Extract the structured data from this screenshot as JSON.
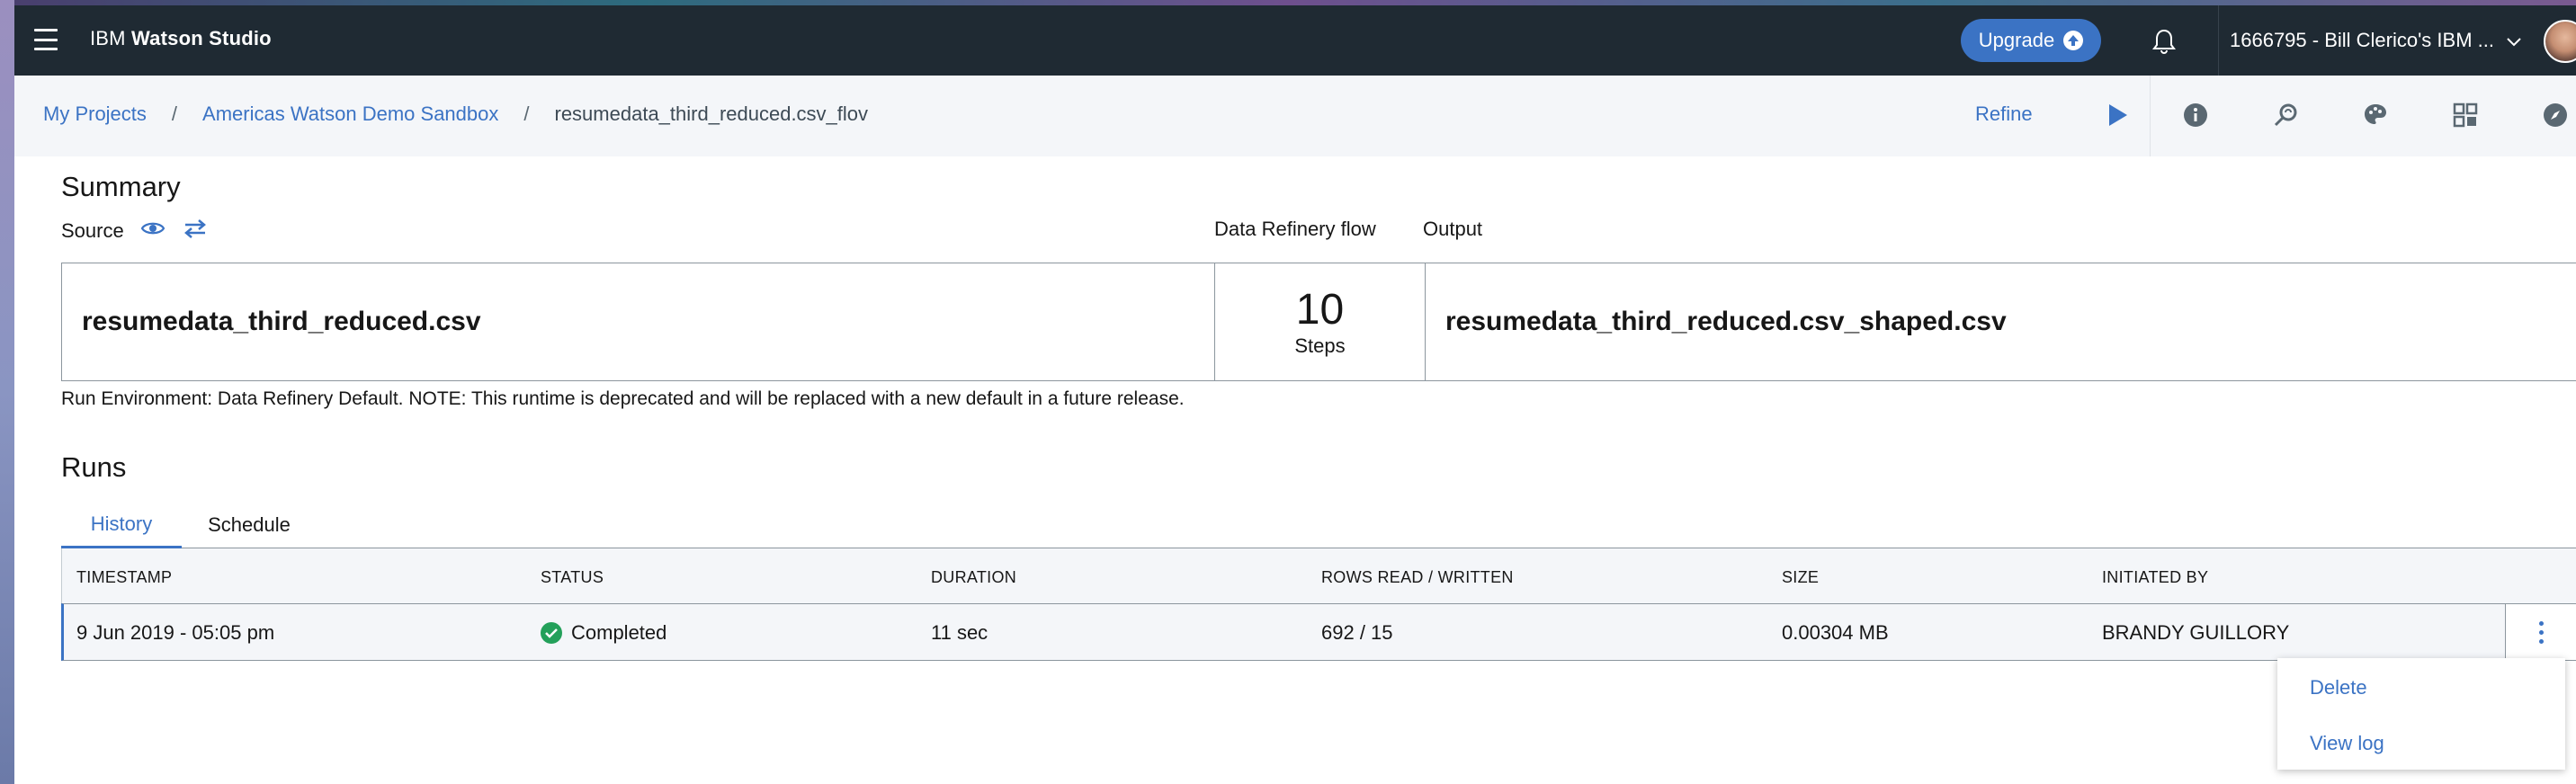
{
  "header": {
    "brand_prefix": "IBM",
    "brand_name": "Watson Studio",
    "upgrade_label": "Upgrade",
    "account_label": "1666795 - Bill Clerico's IBM ..."
  },
  "breadcrumb": {
    "items": [
      "My Projects",
      "Americas Watson Demo Sandbox"
    ],
    "current": "resumedata_third_reduced.csv_flov",
    "separator": "/"
  },
  "actions": {
    "refine_label": "Refine"
  },
  "summary": {
    "title": "Summary",
    "source_label": "Source",
    "flow_label": "Data Refinery flow",
    "output_label": "Output",
    "source_file": "resumedata_third_reduced.csv",
    "steps_count": "10",
    "steps_label": "Steps",
    "output_file": "resumedata_third_reduced.csv_shaped.csv",
    "env_note": "Run Environment: Data Refinery Default. NOTE: This runtime is deprecated and will be replaced with a new default in a future release."
  },
  "runs": {
    "title": "Runs",
    "tabs": [
      "History",
      "Schedule"
    ],
    "columns": [
      "TIMESTAMP",
      "STATUS",
      "DURATION",
      "ROWS READ / WRITTEN",
      "SIZE",
      "INITIATED BY"
    ],
    "rows": [
      {
        "timestamp": "9 Jun 2019 - 05:05 pm",
        "status": "Completed",
        "duration": "11 sec",
        "rows": "692 / 15",
        "size": "0.00304 MB",
        "initiated_by": "BRANDY GUILLORY"
      }
    ]
  },
  "overflow_menu": {
    "items": [
      "Delete",
      "View log"
    ]
  },
  "colors": {
    "topbar": "#1f2a33",
    "accent": "#3b73c4",
    "success": "#23a05a"
  }
}
